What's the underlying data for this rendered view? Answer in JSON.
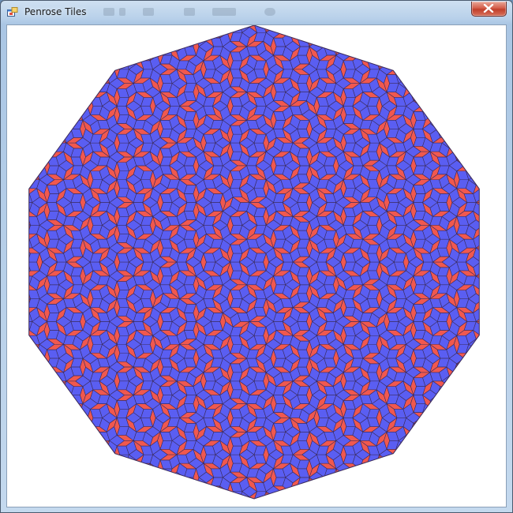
{
  "window": {
    "title": "Penrose Tiles",
    "icons": {
      "app": "app-window-icon",
      "close": "close-icon"
    }
  },
  "tiling": {
    "shape": "decagon",
    "tile_types": [
      "thick-rhombus",
      "thin-rhombus"
    ],
    "colors": {
      "thick_rhombus": "#5a5ef2",
      "thin_rhombus": "#f0584f",
      "outline": "#3a2a5a",
      "background": "#ffffff"
    }
  }
}
